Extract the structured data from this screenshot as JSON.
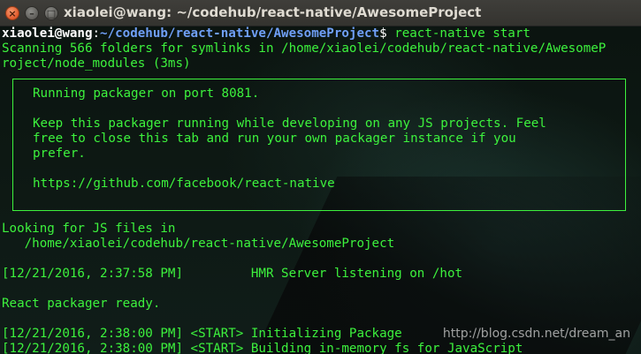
{
  "window": {
    "title": "xiaolei@wang: ~/codehub/react-native/AwesomeProject",
    "close_glyph": "×",
    "minimize_glyph": "–",
    "maximize_glyph": "□"
  },
  "terminal": {
    "prompt": {
      "user_host": "xiaolei@wang",
      "separator": ":",
      "path": "~/codehub/react-native/AwesomeProject",
      "symbol": "$ ",
      "command": "react-native start"
    },
    "scan_line_1": "Scanning 566 folders for symlinks in /home/xiaolei/codehub/react-native/AwesomeP",
    "scan_line_2": "roject/node_modules (3ms)",
    "box": {
      "line_1": "Running packager on port 8081.",
      "line_2": "Keep this packager running while developing on any JS projects. Feel",
      "line_3": "free to close this tab and run your own packager instance if you",
      "line_4": "prefer.",
      "line_5": "https://github.com/facebook/react-native"
    },
    "looking_line_1": "Looking for JS files in",
    "looking_line_2": "   /home/xiaolei/codehub/react-native/AwesomeProject",
    "hmr_line": "[12/21/2016, 2:37:58 PM]         HMR Server listening on /hot",
    "ready_line": "React packager ready.",
    "start_line_1": "[12/21/2016, 2:38:00 PM] <START> Initializing Package",
    "start_line_2": "[12/21/2016, 2:38:00 PM] <START> Building in-memory fs for JavaScript"
  },
  "watermark": "http://blog.csdn.net/dream_an",
  "colors": {
    "terminal_text": "#3df23d",
    "prompt_path": "#6f9ff6",
    "close_button": "#e0582a"
  }
}
